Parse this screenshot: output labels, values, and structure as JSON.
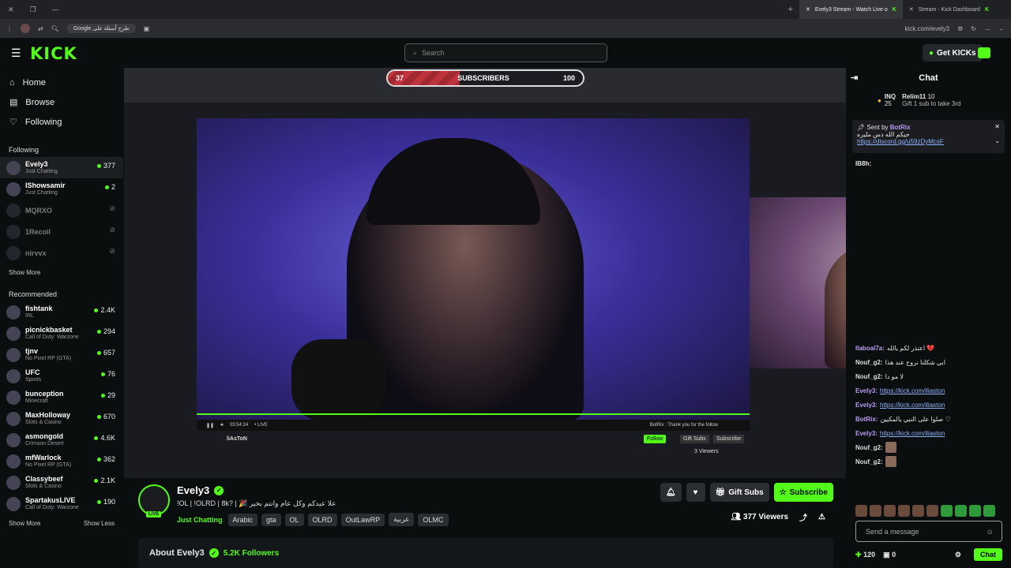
{
  "browser": {
    "tabs": [
      {
        "label": "Evely3 Stream - Watch Live o",
        "active": true
      },
      {
        "label": "Stream - Kick Dashboard",
        "active": false
      }
    ],
    "google_chip": "Google طرح أسئلة على",
    "url": "kick.com/evely3"
  },
  "header": {
    "logo": "KICK",
    "search_placeholder": "Search",
    "get_kicks": "Get KICKs"
  },
  "sidebar": {
    "nav": [
      {
        "label": "Home",
        "icon": "home-icon"
      },
      {
        "label": "Browse",
        "icon": "browse-icon"
      },
      {
        "label": "Following",
        "icon": "heart-icon"
      }
    ],
    "following_title": "Following",
    "following": [
      {
        "name": "Evely3",
        "category": "Just Chatting",
        "viewers": "377",
        "live": true
      },
      {
        "name": "lShowsamir",
        "category": "Just Chatting",
        "viewers": "2",
        "live": true
      },
      {
        "name": "MQRXO",
        "category": "",
        "viewers": "",
        "live": false
      },
      {
        "name": "1Recoil",
        "category": "",
        "viewers": "",
        "live": false
      },
      {
        "name": "nirvvx",
        "category": "",
        "viewers": "",
        "live": false
      }
    ],
    "show_more": "Show More",
    "recommended_title": "Recommended",
    "recommended": [
      {
        "name": "fishtank",
        "category": "IRL",
        "viewers": "2.4K"
      },
      {
        "name": "picnickbasket",
        "category": "Call of Duty: Warzone",
        "viewers": "294"
      },
      {
        "name": "tjnv",
        "category": "No Pixel RP (GTA)",
        "viewers": "657"
      },
      {
        "name": "UFC",
        "category": "Sports",
        "viewers": "76"
      },
      {
        "name": "bunception",
        "category": "Minecraft",
        "viewers": "29"
      },
      {
        "name": "MaxHolloway",
        "category": "Slots & Casino",
        "viewers": "670"
      },
      {
        "name": "asmongold",
        "category": "Crimson Desert",
        "viewers": "4.6K"
      },
      {
        "name": "mfWarlock",
        "category": "No Pixel RP (GTA)",
        "viewers": "362"
      },
      {
        "name": "Classybeef",
        "category": "Slots & Casino",
        "viewers": "2.1K"
      },
      {
        "name": "SpartakusLIVE",
        "category": "Call of Duty: Warzone",
        "viewers": "190"
      }
    ],
    "show_more2": "Show More",
    "show_less": "Show Less"
  },
  "player": {
    "sub_goal_current": "37",
    "sub_goal_label": "SUBSCRIBERS",
    "sub_goal_target": "100",
    "sub_goal_progress": 0.37,
    "time": "03:54:24",
    "live": "• LIVE",
    "ticker": "BotRix : Thank you for the follow",
    "inner_streamer": "liAsToN",
    "inner_follow": "Follow",
    "inner_gift": "Gift Subs",
    "inner_sub": "Subscribe",
    "inner_viewers": "3 Viewers"
  },
  "streamer": {
    "name": "Evely3",
    "live_badge": "LIVE",
    "title": "!OL | !OLRD | 8k? | 🎉 علا عيدكم وكل عام وانتم بخير",
    "category": "Just Chatting",
    "tags": [
      "Arabic",
      "gta",
      "OL",
      "OLRD",
      "OutLawRP",
      "عربية",
      "OLMC"
    ],
    "gift_subs": "Gift Subs",
    "subscribe": "Subscribe",
    "viewers": "377 Viewers"
  },
  "about": {
    "title": "About Evely3",
    "followers": "5.2K Followers"
  },
  "chat": {
    "title": "Chat",
    "leaderboard": [
      {
        "name": "INQ",
        "score": "25"
      },
      {
        "name": "Relim11",
        "score": "10"
      }
    ],
    "leaderboard_note": "Gift 1 sub to take 3rd",
    "pinned_by": "Sent by",
    "pinned_user": "BotRix",
    "pinned_text": "حيكم الله دس مليره",
    "pinned_link": "https://discord.gg/u59zDyMcsF",
    "pinned_user2": "IB8h:",
    "messages": [
      {
        "user": "llaboal7a:",
        "text": "اعتذر لكم يالله 💔",
        "color": "#b99cf3",
        "link": ""
      },
      {
        "user": "Nouf_g2:",
        "text": "ابي شكلنا نروح عند هذا",
        "color": "#dddddd",
        "link": ""
      },
      {
        "user": "Nouf_g2:",
        "text": "لا مو دا",
        "color": "#dddddd",
        "link": ""
      },
      {
        "user": "Evely3:",
        "text": "",
        "color": "#b99cf3",
        "link": "https://kick.com/iliaston"
      },
      {
        "user": "Evely3:",
        "text": "",
        "color": "#b99cf3",
        "link": "https://kick.com/iliaston"
      },
      {
        "user": "BotRix:",
        "text": "صلوا على النبي يالمكيين ♡",
        "color": "#b99cf3",
        "link": ""
      },
      {
        "user": "Evely3:",
        "text": "",
        "color": "#b99cf3",
        "link": "https://kick.com/iliaston"
      },
      {
        "user": "Nouf_g2:",
        "text": "",
        "color": "#dddddd",
        "link": ""
      },
      {
        "user": "Nouf_g2:",
        "text": "",
        "color": "#dddddd",
        "link": ""
      }
    ],
    "input_placeholder": "Send a message",
    "kicks": "120",
    "gifts": "0",
    "chat_button": "Chat"
  }
}
